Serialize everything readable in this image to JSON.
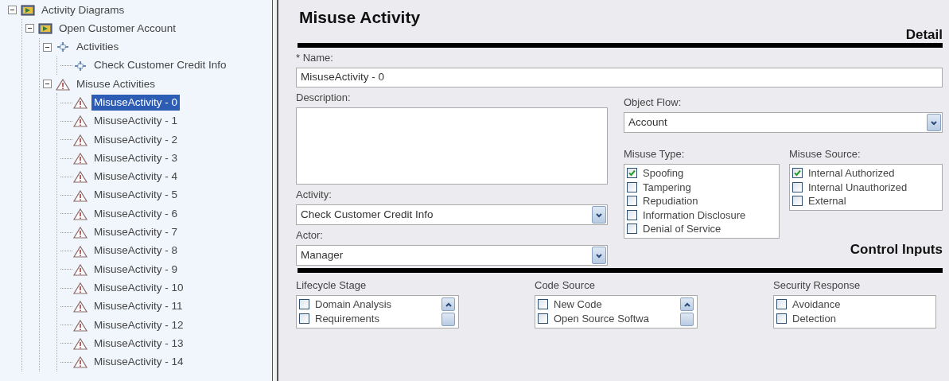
{
  "tree": [
    {
      "label": "Activity Diagrams",
      "kind": "diagram",
      "expanded": true,
      "selected": false,
      "children": [
        {
          "label": "Open Customer Account",
          "kind": "diagram",
          "expanded": true,
          "selected": false,
          "children": [
            {
              "label": "Activities",
              "kind": "activity",
              "expanded": true,
              "selected": false,
              "children": [
                {
                  "label": "Check Customer Credit Info",
                  "kind": "activity",
                  "selected": false
                }
              ]
            },
            {
              "label": "Misuse Activities",
              "kind": "misuse",
              "expanded": true,
              "selected": false,
              "children": [
                {
                  "label": "MisuseActivity - 0",
                  "kind": "misuse",
                  "selected": true
                },
                {
                  "label": "MisuseActivity - 1",
                  "kind": "misuse",
                  "selected": false
                },
                {
                  "label": "MisuseActivity - 2",
                  "kind": "misuse",
                  "selected": false
                },
                {
                  "label": "MisuseActivity - 3",
                  "kind": "misuse",
                  "selected": false
                },
                {
                  "label": "MisuseActivity - 4",
                  "kind": "misuse",
                  "selected": false
                },
                {
                  "label": "MisuseActivity - 5",
                  "kind": "misuse",
                  "selected": false
                },
                {
                  "label": "MisuseActivity - 6",
                  "kind": "misuse",
                  "selected": false
                },
                {
                  "label": "MisuseActivity - 7",
                  "kind": "misuse",
                  "selected": false
                },
                {
                  "label": "MisuseActivity - 8",
                  "kind": "misuse",
                  "selected": false
                },
                {
                  "label": "MisuseActivity - 9",
                  "kind": "misuse",
                  "selected": false
                },
                {
                  "label": "MisuseActivity - 10",
                  "kind": "misuse",
                  "selected": false
                },
                {
                  "label": "MisuseActivity - 11",
                  "kind": "misuse",
                  "selected": false
                },
                {
                  "label": "MisuseActivity - 12",
                  "kind": "misuse",
                  "selected": false
                },
                {
                  "label": "MisuseActivity - 13",
                  "kind": "misuse",
                  "selected": false
                },
                {
                  "label": "MisuseActivity - 14",
                  "kind": "misuse",
                  "selected": false
                }
              ]
            }
          ]
        }
      ]
    }
  ],
  "form": {
    "title": "Misuse Activity",
    "detail_heading": "Detail",
    "name": {
      "label": "* Name:",
      "value": "MisuseActivity - 0"
    },
    "description": {
      "label": "Description:"
    },
    "object_flow": {
      "label": "Object Flow:",
      "value": "Account"
    },
    "activity": {
      "label": "Activity:",
      "value": "Check Customer Credit Info"
    },
    "actor": {
      "label": "Actor:",
      "value": "Manager"
    },
    "misuse_type": {
      "label": "Misuse Type:",
      "items": [
        {
          "label": "Spoofing",
          "checked": true
        },
        {
          "label": "Tampering",
          "checked": false
        },
        {
          "label": "Repudiation",
          "checked": false
        },
        {
          "label": "Information Disclosure",
          "checked": false
        },
        {
          "label": "Denial of Service",
          "checked": false
        }
      ]
    },
    "misuse_source": {
      "label": "Misuse Source:",
      "items": [
        {
          "label": "Internal Authorized",
          "checked": true
        },
        {
          "label": "Internal Unauthorized",
          "checked": false
        },
        {
          "label": "External",
          "checked": false
        }
      ]
    },
    "control_heading": "Control Inputs",
    "control_lists": [
      {
        "label": "Lifecycle Stage",
        "scrollable": true,
        "items": [
          {
            "label": "Domain Analysis",
            "checked": false
          },
          {
            "label": "Requirements",
            "checked": false
          }
        ]
      },
      {
        "label": "Code Source",
        "scrollable": true,
        "items": [
          {
            "label": "New Code",
            "checked": false
          },
          {
            "label": "Open Source Softwa",
            "checked": false
          }
        ]
      },
      {
        "label": "Security Response",
        "scrollable": false,
        "items": [
          {
            "label": "Avoidance",
            "checked": false
          },
          {
            "label": "Detection",
            "checked": false
          }
        ]
      }
    ]
  }
}
